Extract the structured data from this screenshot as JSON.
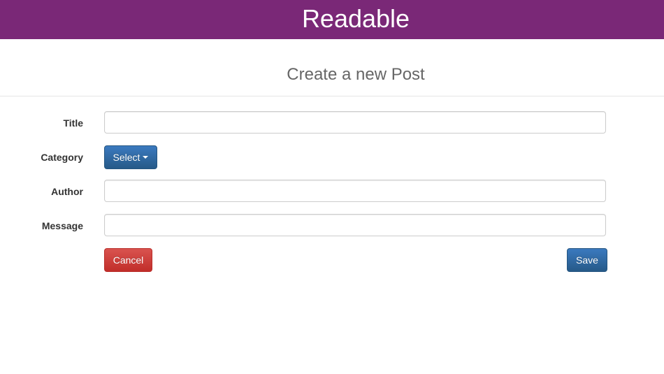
{
  "header": {
    "brand": "Readable"
  },
  "page": {
    "heading": "Create a new Post"
  },
  "form": {
    "title_label": "Title",
    "title_value": "",
    "category_label": "Category",
    "category_button": "Select",
    "author_label": "Author",
    "author_value": "",
    "message_label": "Message",
    "message_value": ""
  },
  "actions": {
    "cancel_label": "Cancel",
    "save_label": "Save"
  },
  "colors": {
    "header_bg": "#7a2877",
    "primary": "#2f6aa9",
    "danger": "#cf3a36"
  },
  "icons": {
    "dropdown_caret": "caret-down-icon"
  }
}
